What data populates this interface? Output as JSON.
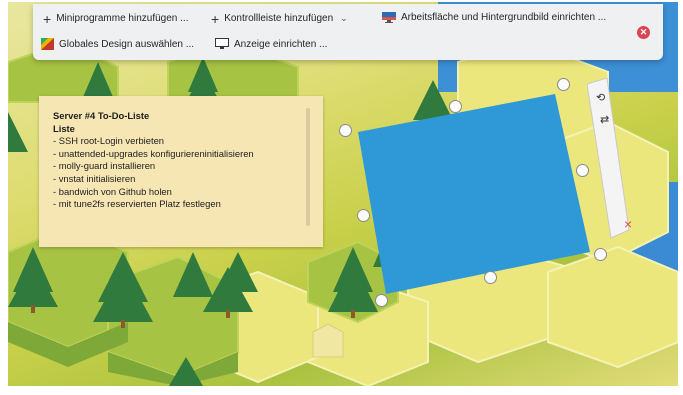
{
  "toolbar": {
    "add_widgets": "Miniprogramme hinzufügen ...",
    "add_panel": "Kontrollleiste hinzufügen",
    "configure_desktop": "Arbeitsfläche und Hintergrundbild einrichten ...",
    "global_theme": "Globales Design auswählen ...",
    "display_config": "Anzeige einrichten ...",
    "icons": {
      "add": "plus-icon",
      "dropdown": "chevron-down-icon",
      "desktop": "desktop-wallpaper-icon",
      "theme": "color-palette-icon",
      "display": "monitor-icon",
      "close": "close-icon"
    }
  },
  "note": {
    "title": "Server #4 To-Do-Liste",
    "subtitle": "Liste",
    "items": [
      "- SSH root-Login verbieten",
      "- unattended-upgrades konfiguriereninitialisieren",
      "- molly-guard installieren",
      "- vnstat initialisieren",
      "- bandwich von Github holen",
      "- mit tune2fs reservierten Platz festlegen"
    ]
  },
  "widget_controls": {
    "icons": [
      "rotate-icon",
      "resize-arrows-icon",
      "remove-icon"
    ]
  },
  "colors": {
    "accent_widget": "#2f99d8",
    "note_bg": "#f6e6b4",
    "close_red": "#da4453"
  }
}
